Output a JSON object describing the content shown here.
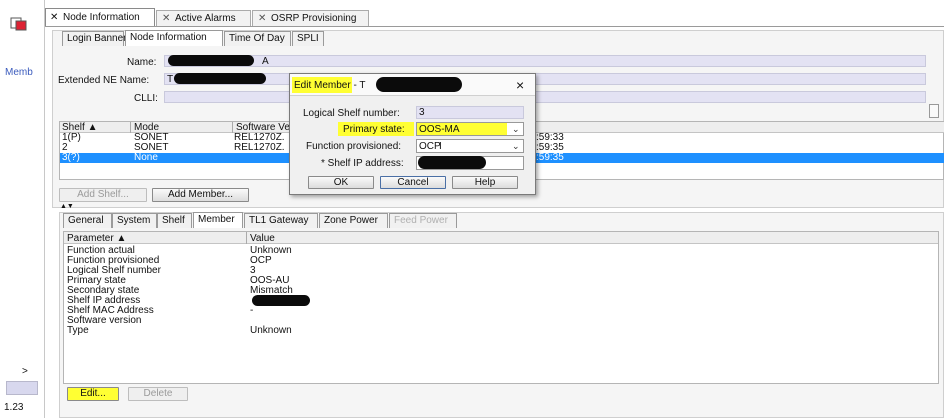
{
  "left": {
    "mem_label": "Memb",
    "arrow": ">",
    "version": "1.23"
  },
  "top_tabs": [
    "Node Information",
    "Active Alarms",
    "OSRP Provisioning"
  ],
  "sub_tabs": [
    "Login Banner",
    "Node Information",
    "Time Of Day",
    "SPLI"
  ],
  "form": {
    "name_label": "Name:",
    "name_value_suffix": "A",
    "ext_label": "Extended NE Name:",
    "ext_value_prefix": "T",
    "clli_label": "CLLI:"
  },
  "shelf_table": {
    "headers": [
      "Shelf ▲",
      "Mode",
      "Software Ve"
    ],
    "rows": [
      {
        "shelf": "1(P)",
        "mode": "SONET",
        "sw": "REL1270Z.",
        "time": ":59:33"
      },
      {
        "shelf": "2",
        "mode": "SONET",
        "sw": "REL1270Z.",
        "time": ":59:35"
      },
      {
        "shelf": "3(?)",
        "mode": "None",
        "sw": "",
        "time": ":59:35"
      }
    ]
  },
  "buttons": {
    "add_shelf": "Add Shelf...",
    "add_member": "Add Member...",
    "edit": "Edit...",
    "delete": "Delete"
  },
  "lower_tabs": [
    "General",
    "System",
    "Shelf",
    "Member",
    "TL1 Gateway",
    "Zone Power",
    "Feed Power"
  ],
  "param_table": {
    "headers": [
      "Parameter ▲",
      "Value"
    ],
    "rows": [
      {
        "p": "Function actual",
        "v": "Unknown"
      },
      {
        "p": "Function provisioned",
        "v": "OCP"
      },
      {
        "p": "Logical Shelf number",
        "v": "3"
      },
      {
        "p": "Primary state",
        "v": "OOS-AU"
      },
      {
        "p": "Secondary state",
        "v": "Mismatch"
      },
      {
        "p": "Shelf IP address",
        "v": ""
      },
      {
        "p": "Shelf MAC Address",
        "v": "-"
      },
      {
        "p": "Software version",
        "v": ""
      },
      {
        "p": "Type",
        "v": "Unknown"
      }
    ]
  },
  "dialog": {
    "title": "Edit Member - T",
    "close": "×",
    "logical_label": "Logical Shelf number:",
    "logical_value": "3",
    "primary_label": "Primary state:",
    "primary_value": "OOS-MA",
    "function_label": "Function provisioned:",
    "function_value": "OCP",
    "ip_label": "* Shelf IP address:",
    "ok": "OK",
    "cancel": "Cancel",
    "help": "Help"
  },
  "colors": {
    "field": "#e3e2f3",
    "selection": "#1e90ff",
    "highlight": "#ffff33",
    "title_blue": "#3b5bbd"
  }
}
